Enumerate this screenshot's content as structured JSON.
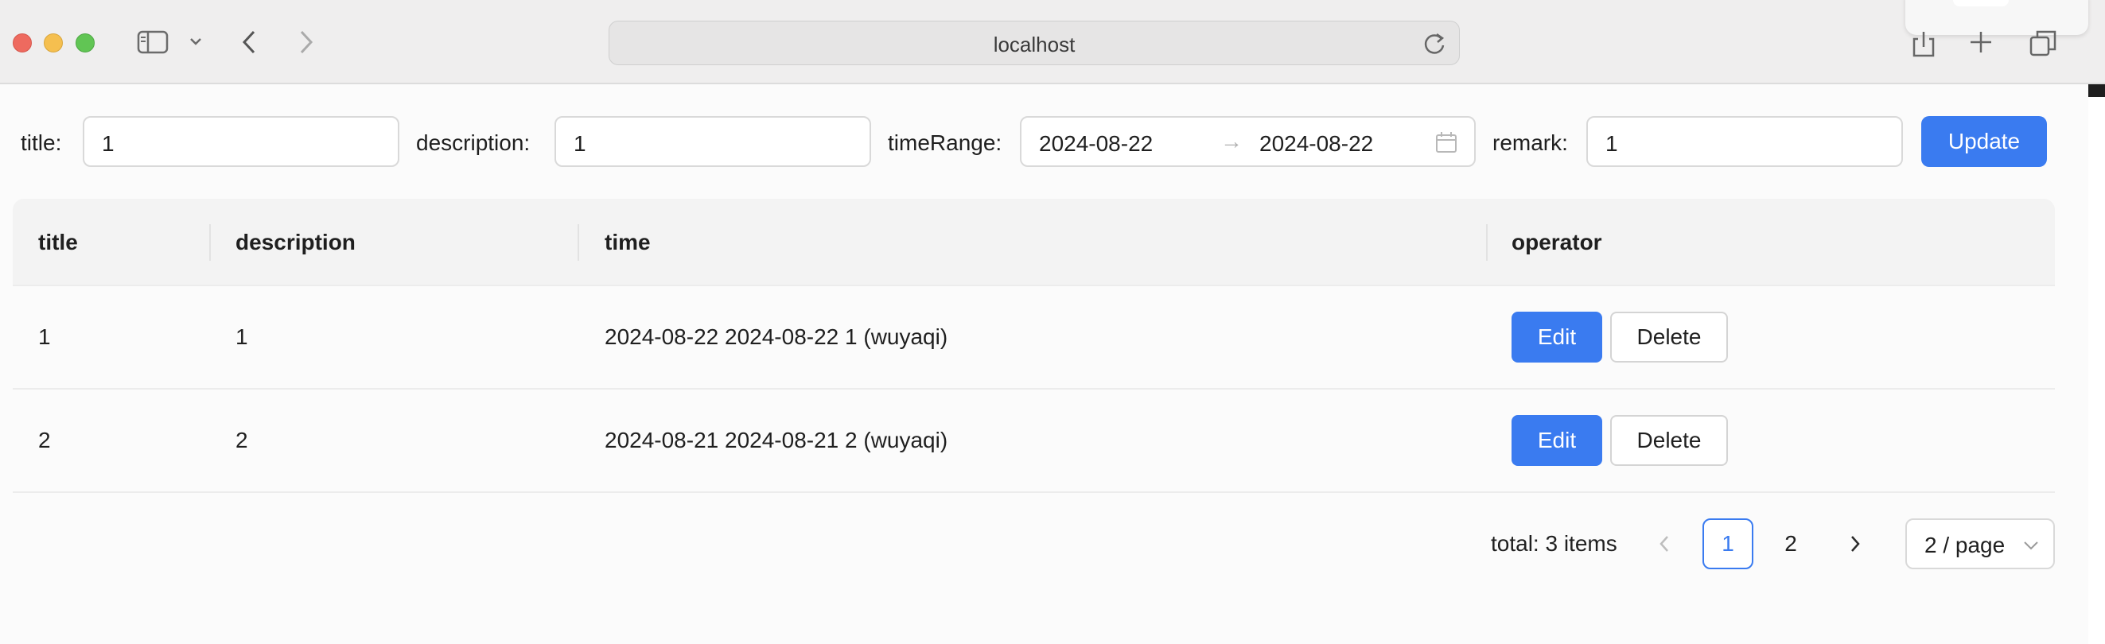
{
  "browser": {
    "url": "localhost"
  },
  "form": {
    "title_label": "title:",
    "title_value": "1",
    "description_label": "description:",
    "description_value": "1",
    "timerange_label": "timeRange:",
    "timerange_start": "2024-08-22",
    "timerange_separator": "→",
    "timerange_end": "2024-08-22",
    "remark_label": "remark:",
    "remark_value": "1",
    "update_label": "Update"
  },
  "table": {
    "headers": [
      "title",
      "description",
      "time",
      "operator"
    ],
    "rows": [
      {
        "title": "1",
        "description": "1",
        "time": "2024-08-22 2024-08-22 1 (wuyaqi)",
        "edit_label": "Edit",
        "delete_label": "Delete"
      },
      {
        "title": "2",
        "description": "2",
        "time": "2024-08-21 2024-08-21 2 (wuyaqi)",
        "edit_label": "Edit",
        "delete_label": "Delete"
      }
    ]
  },
  "pagination": {
    "total_text": "total: 3 items",
    "pages": [
      "1",
      "2"
    ],
    "current_page": "1",
    "page_size_label": "2 / page"
  },
  "colors": {
    "accent": "#3a7bf0",
    "traffic_red": "#ee6a5f",
    "traffic_yellow": "#f5bf4f",
    "traffic_green": "#61c554"
  }
}
